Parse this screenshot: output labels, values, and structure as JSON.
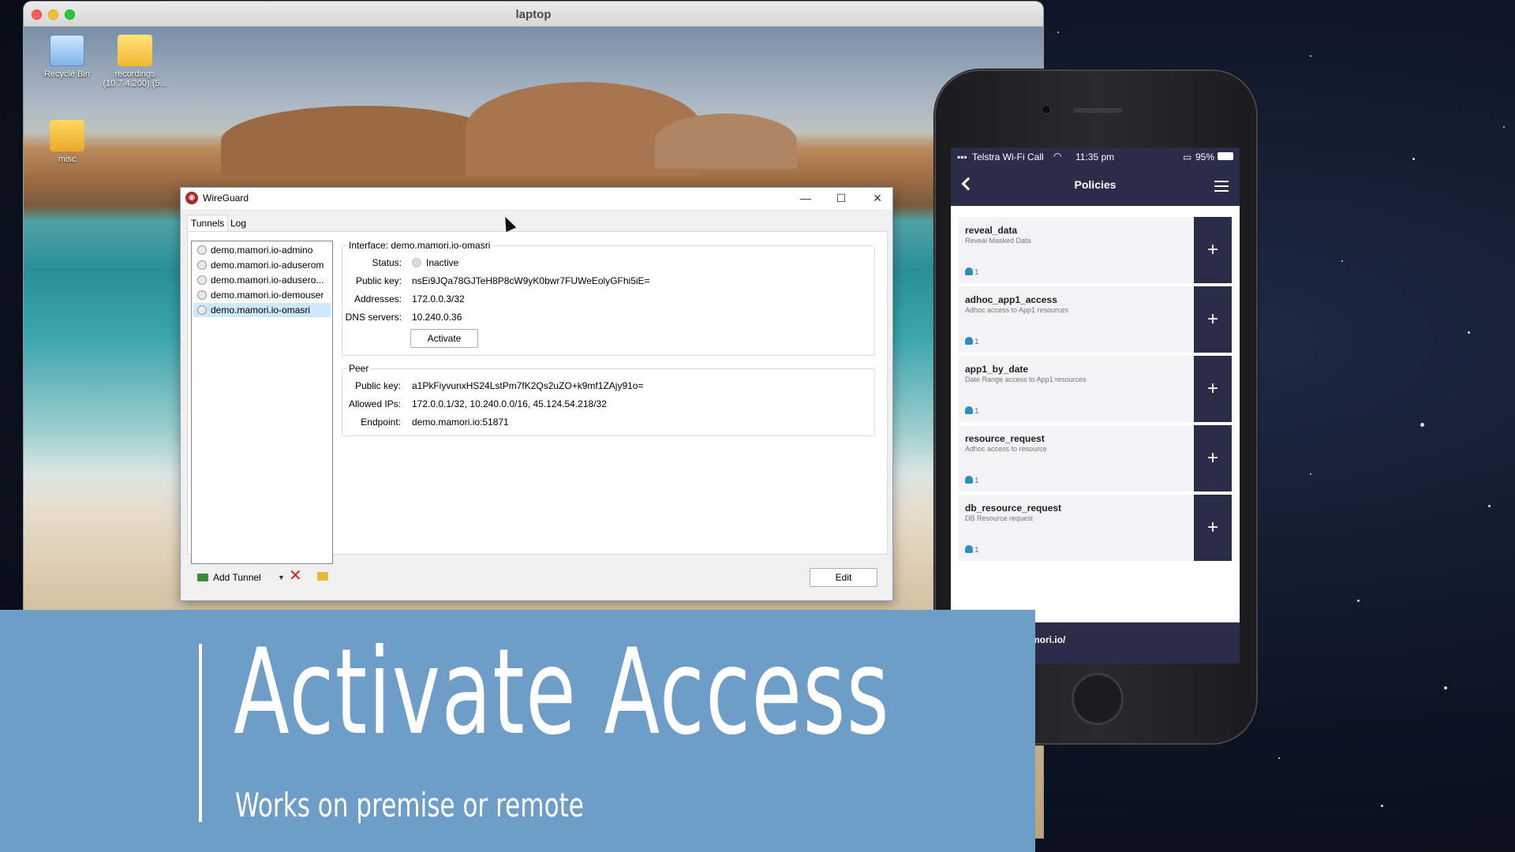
{
  "mac_window": {
    "title": "laptop"
  },
  "desktop_icons": [
    {
      "label": "Recycle Bin"
    },
    {
      "label": "recordings (10.7.4.200) (5..."
    },
    {
      "label": "misc"
    }
  ],
  "wireguard": {
    "title": "WireGuard",
    "tabs": [
      "Tunnels",
      "Log"
    ],
    "active_tab": "Tunnels",
    "tunnels": [
      "demo.mamori.io-admino",
      "demo.mamori.io-aduserom",
      "demo.mamori.io-adusero...",
      "demo.mamori.io-demouser",
      "demo.mamori.io-omasri"
    ],
    "selected_tunnel": "demo.mamori.io-omasri",
    "interface": {
      "header": "Interface: demo.mamori.io-omasri",
      "status_label": "Status:",
      "status_value": "Inactive",
      "public_key_label": "Public key:",
      "public_key": "nsEi9JQa78GJTeH8P8cW9yK0bwr7FUWeEolyGFhi5iE=",
      "addresses_label": "Addresses:",
      "addresses": "172.0.0.3/32",
      "dns_label": "DNS servers:",
      "dns": "10.240.0.36",
      "activate_label": "Activate"
    },
    "peer": {
      "header": "Peer",
      "public_key_label": "Public key:",
      "public_key": "a1PkFiyvunxHS24LstPm7fK2Qs2uZO+k9mf1ZAjy91o=",
      "allowed_ips_label": "Allowed IPs:",
      "allowed_ips": "172.0.0.1/32, 10.240.0.0/16, 45.124.54.218/32",
      "endpoint_label": "Endpoint:",
      "endpoint": "demo.mamori.io:51871"
    },
    "toolbar": {
      "add_tunnel": "Add Tunnel"
    },
    "edit_label": "Edit"
  },
  "phone": {
    "carrier": "Telstra Wi-Fi Call",
    "time": "11:35 pm",
    "battery": "95%",
    "nav_title": "Policies",
    "policies": [
      {
        "name": "reveal_data",
        "desc": "Reveal Masked Data",
        "users": "1"
      },
      {
        "name": "adhoc_app1_access",
        "desc": "Adhoc access to App1 resources",
        "users": "1"
      },
      {
        "name": "app1_by_date",
        "desc": "Date Range access to App1 resources",
        "users": "1"
      },
      {
        "name": "resource_request",
        "desc": "Adhoc access to resource",
        "users": "1"
      },
      {
        "name": "db_resource_request",
        "desc": "DB Resource request",
        "users": "1"
      }
    ],
    "footer_text": "mori.io/"
  },
  "banner": {
    "title": "Activate Access",
    "subtitle": "Works on premise or remote"
  },
  "colors": {
    "banner": "#6e9dc7",
    "phone_accent": "#2a2d47",
    "delete_red": "#d2221f"
  }
}
